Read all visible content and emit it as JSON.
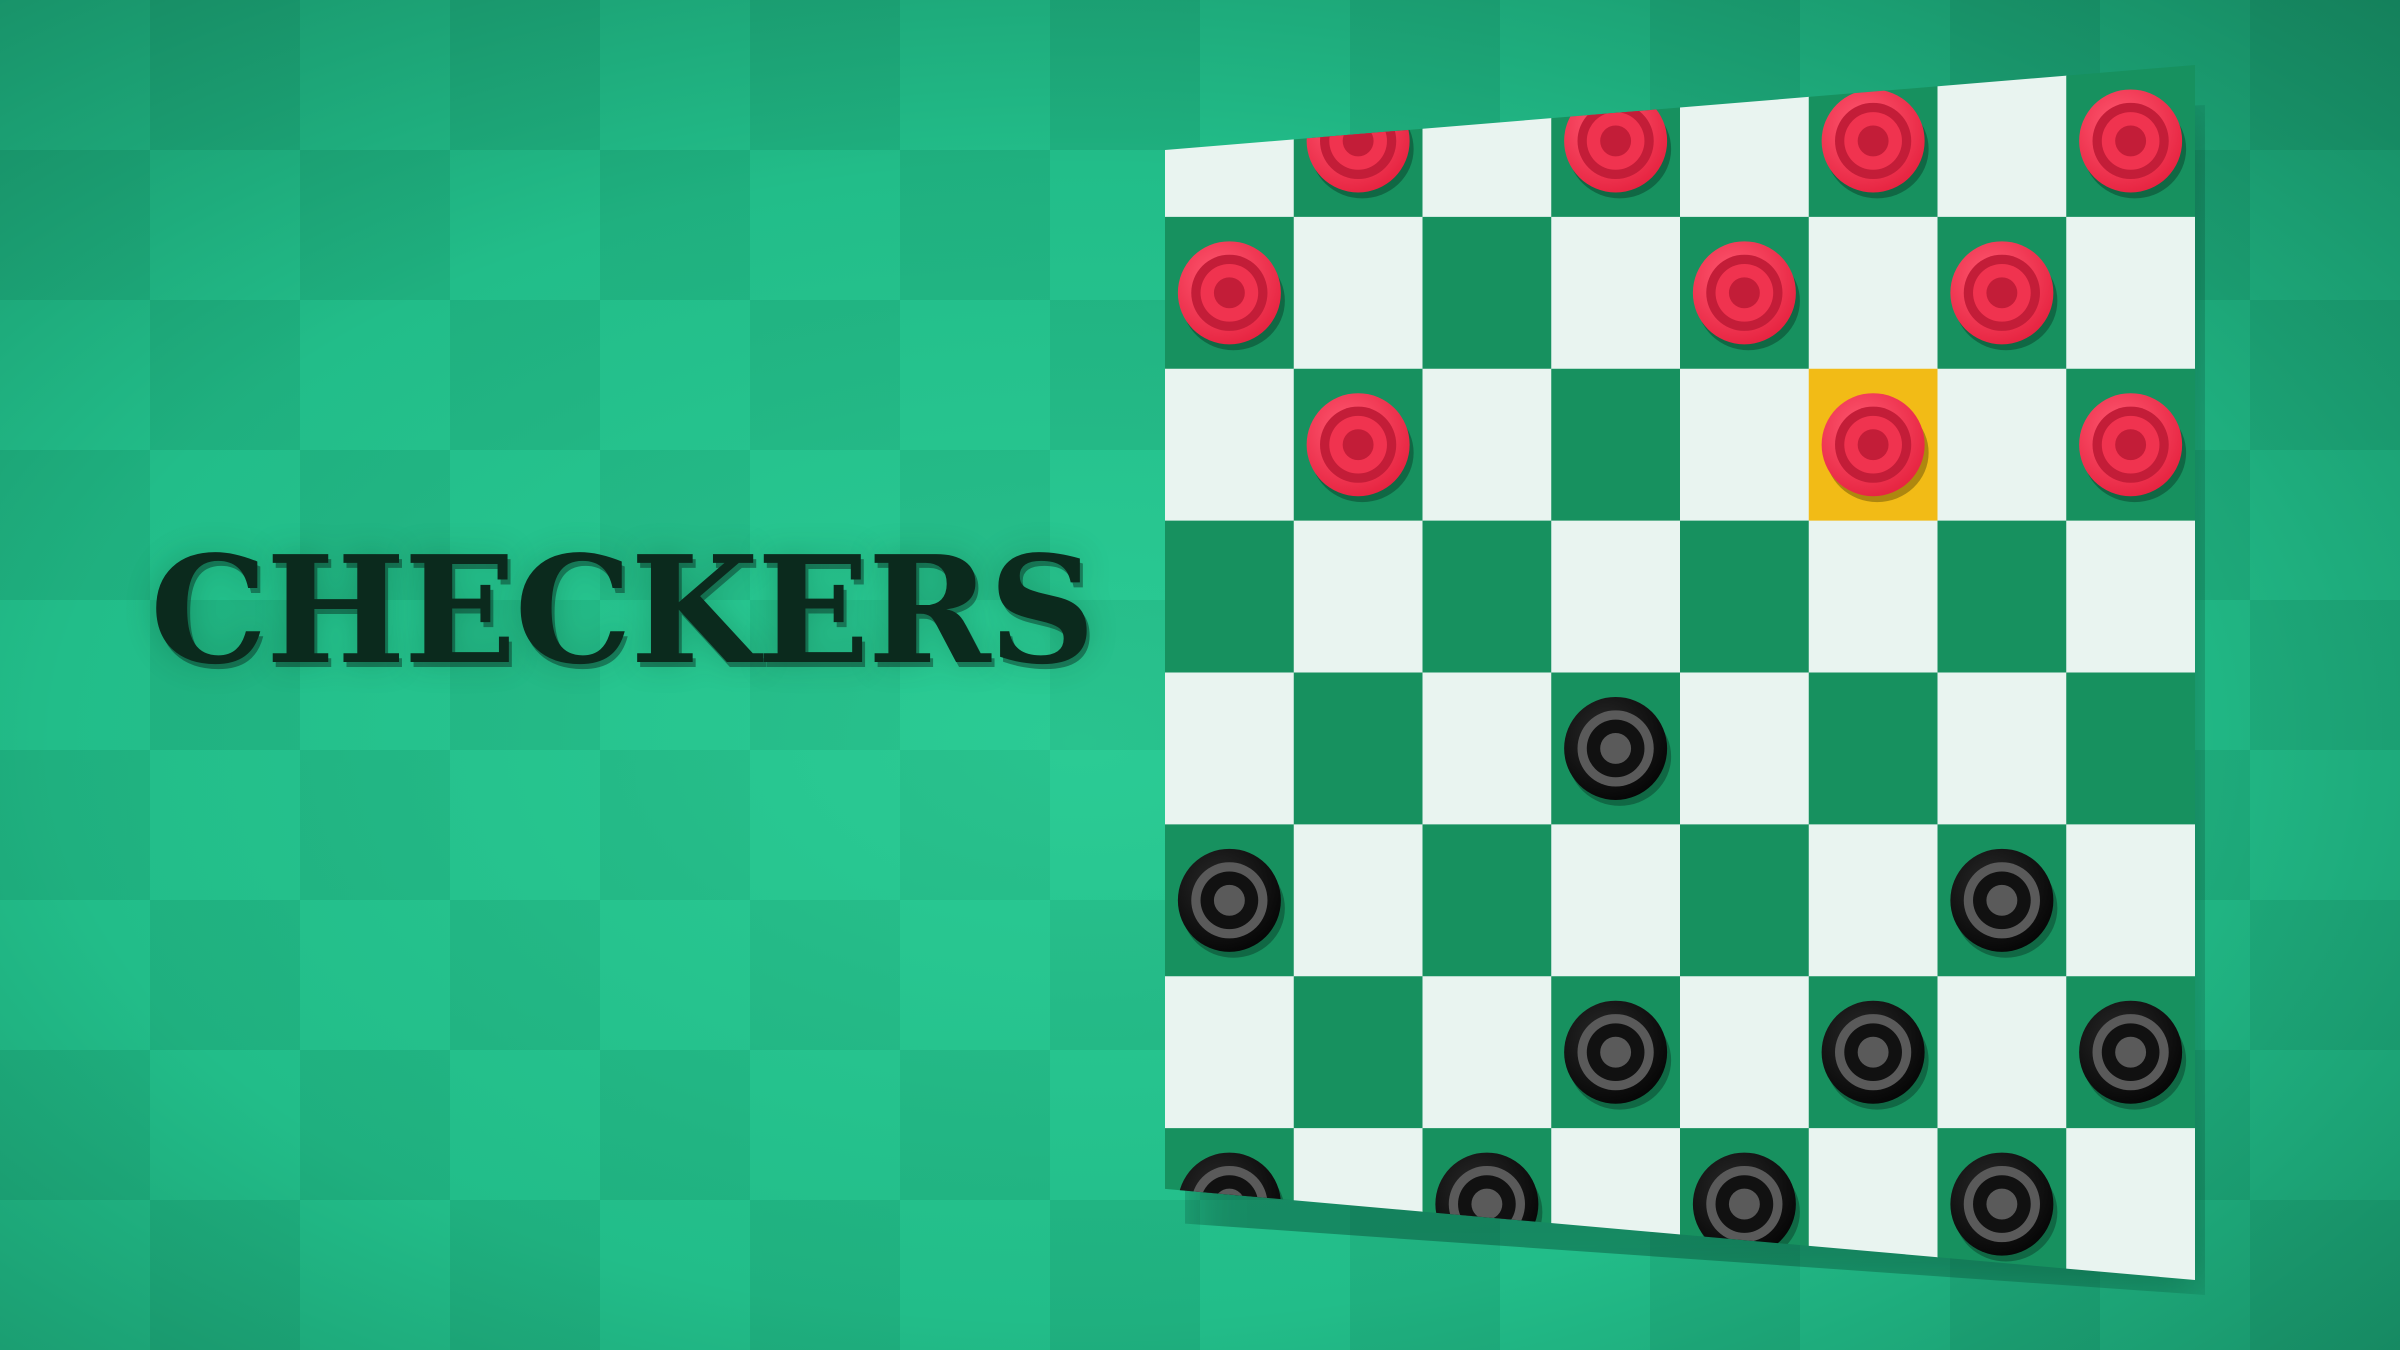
{
  "title": "CHECKERS",
  "colors": {
    "background": "#22bd89",
    "light_square": "#e9f4f0",
    "dark_square": "#17915f",
    "highlight": "#f2bb16",
    "red_piece": "#f0334f",
    "red_piece_inner": "#c31d38",
    "black_piece": "#111111",
    "black_piece_inner": "#5a5a5a",
    "title_text": "#0b2a1d"
  },
  "board": {
    "rows": 8,
    "cols": 8,
    "selected": {
      "row": 2,
      "col": 5
    },
    "pieces": [
      {
        "color": "red",
        "row": 0,
        "col": 1
      },
      {
        "color": "red",
        "row": 0,
        "col": 3
      },
      {
        "color": "red",
        "row": 0,
        "col": 5
      },
      {
        "color": "red",
        "row": 0,
        "col": 7
      },
      {
        "color": "red",
        "row": 1,
        "col": 0
      },
      {
        "color": "red",
        "row": 1,
        "col": 4
      },
      {
        "color": "red",
        "row": 1,
        "col": 6
      },
      {
        "color": "red",
        "row": 2,
        "col": 1
      },
      {
        "color": "red",
        "row": 2,
        "col": 5
      },
      {
        "color": "red",
        "row": 2,
        "col": 7
      },
      {
        "color": "black",
        "row": 4,
        "col": 3
      },
      {
        "color": "black",
        "row": 5,
        "col": 0
      },
      {
        "color": "black",
        "row": 5,
        "col": 6
      },
      {
        "color": "black",
        "row": 6,
        "col": 3
      },
      {
        "color": "black",
        "row": 6,
        "col": 5
      },
      {
        "color": "black",
        "row": 6,
        "col": 7
      },
      {
        "color": "black",
        "row": 7,
        "col": 0
      },
      {
        "color": "black",
        "row": 7,
        "col": 2
      },
      {
        "color": "black",
        "row": 7,
        "col": 4
      },
      {
        "color": "black",
        "row": 7,
        "col": 6
      }
    ]
  }
}
